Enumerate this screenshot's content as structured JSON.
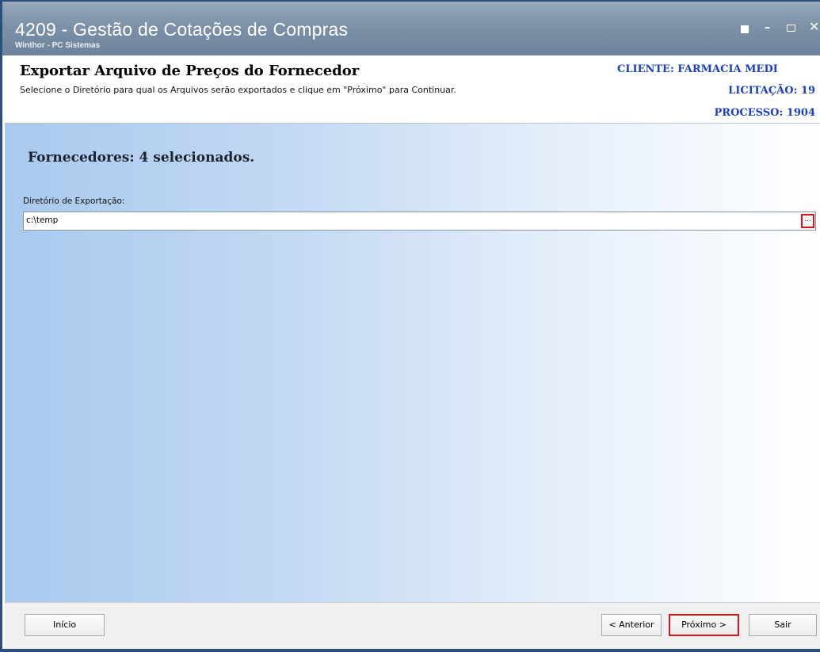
{
  "window": {
    "title": "4209 - Gestão de Cotações de Compras",
    "subtitle": "Winthor - PC Sistemas",
    "controls": [
      "restore-icon",
      "minimize-icon",
      "maximize-icon",
      "close-icon"
    ]
  },
  "header": {
    "title": "Exportar Arquivo de Preços do Fornecedor",
    "description": "Selecione o Diretório para qual os Arquivos serão exportados e clique em \"Próximo\" para Continuar.",
    "cliente": "CLIENTE: FARMACIA MEDI",
    "licitacao": "LICITAÇÃO: 19",
    "processo": "PROCESSO: 1904"
  },
  "main": {
    "fornecedores_label": "Fornecedores: 4 selecionados.",
    "dir_label": "Diretório de Exportação:",
    "dir_value": "c:\\temp",
    "browse_label": "..."
  },
  "footer": {
    "inicio": "Início",
    "anterior": "< Anterior",
    "proximo": "Próximo >",
    "sair": "Sair"
  },
  "colors": {
    "title_bar": "#7d91a8",
    "info_text": "#1a3fc0",
    "highlight": "#d8141c",
    "gradient_start": "#a9c9ee"
  }
}
